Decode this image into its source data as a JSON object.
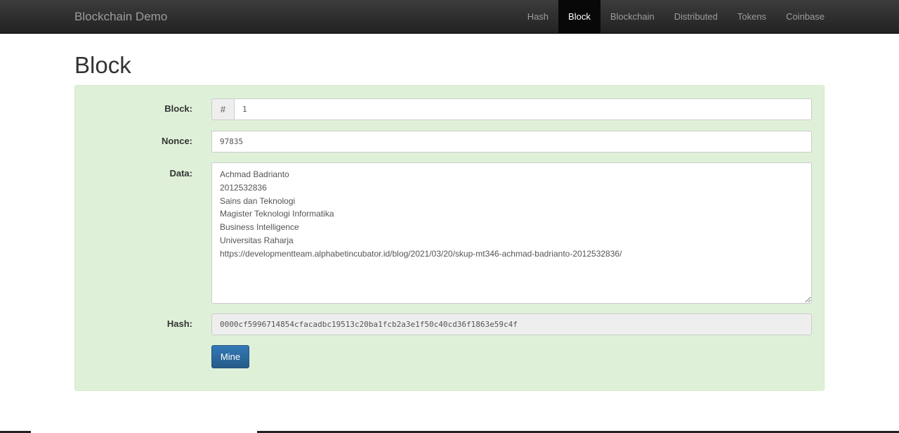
{
  "navbar": {
    "brand": "Blockchain Demo",
    "items": [
      {
        "label": "Hash"
      },
      {
        "label": "Block"
      },
      {
        "label": "Blockchain"
      },
      {
        "label": "Distributed"
      },
      {
        "label": "Tokens"
      },
      {
        "label": "Coinbase"
      }
    ],
    "active": "Block"
  },
  "page": {
    "title": "Block"
  },
  "form": {
    "block_label": "Block:",
    "block_addon": "#",
    "block_value": "1",
    "nonce_label": "Nonce:",
    "nonce_value": "97835",
    "data_label": "Data:",
    "data_value": "Achmad Badrianto\n2012532836\nSains dan Teknologi\nMagister Teknologi Informatika\nBusiness Intelligence\nUniversitas Raharja\nhttps://developmentteam.alphabetincubator.id/blog/2021/03/20/skup-mt346-achmad-badrianto-2012532836/",
    "hash_label": "Hash:",
    "hash_value": "0000cf5996714854cfacadbc19513c20ba1fcb2a3e1f50c40cd36f1863e59c4f",
    "mine_label": "Mine"
  },
  "colors": {
    "navbar": "#222222",
    "well_background": "#dff0d8",
    "primary_button": "#337ab7"
  }
}
